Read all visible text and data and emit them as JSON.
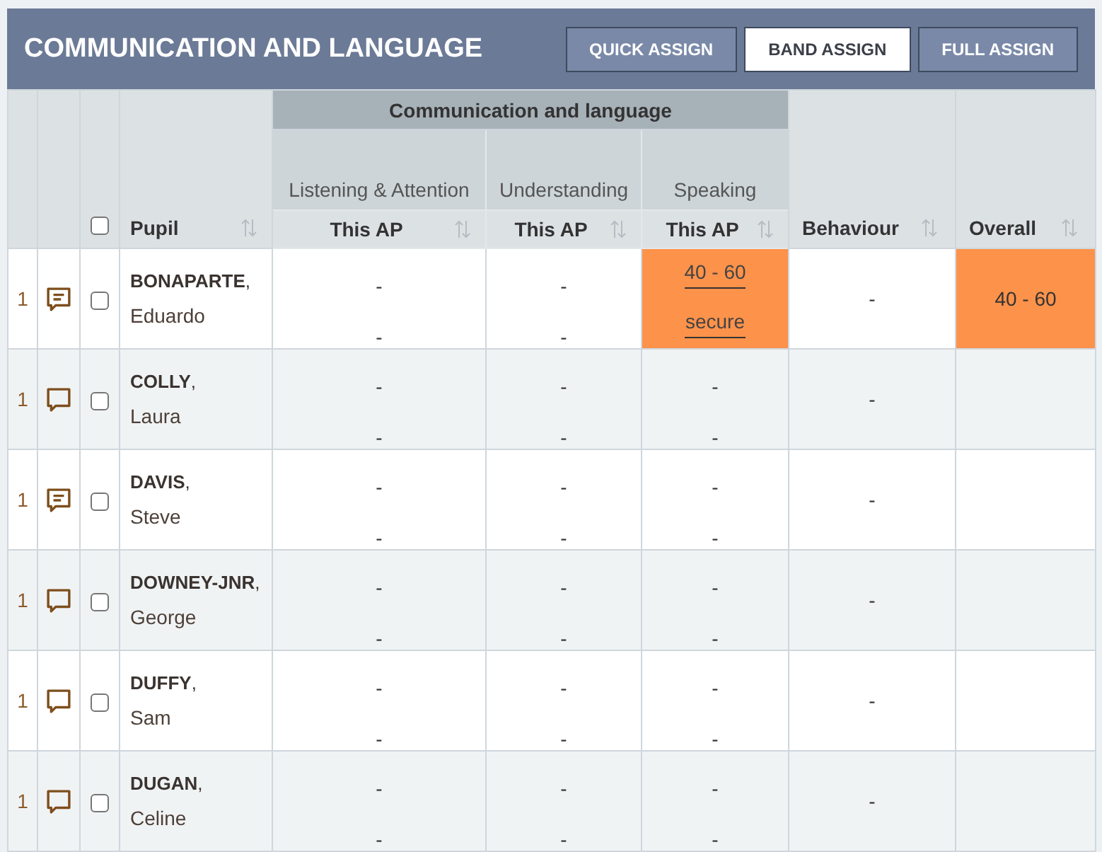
{
  "header": {
    "title": "COMMUNICATION AND LANGUAGE",
    "buttons": [
      {
        "label": "QUICK ASSIGN",
        "selected": false
      },
      {
        "label": "BAND ASSIGN",
        "selected": true
      },
      {
        "label": "FULL ASSIGN",
        "selected": false
      }
    ]
  },
  "table": {
    "select_all": {
      "checked": false
    },
    "pupil_heading": "Pupil",
    "group_heading": "Communication and language",
    "aspects": [
      {
        "name": "Listening & Attention",
        "heading": "This AP"
      },
      {
        "name": "Understanding",
        "heading": "This AP"
      },
      {
        "name": "Speaking",
        "heading": "This AP"
      }
    ],
    "behaviour_heading": "Behaviour",
    "overall_heading": "Overall",
    "rows": [
      {
        "number": "1",
        "has_comments": true,
        "checked": false,
        "surname": "**BONAPARTE**,",
        "first_name": "Eduardo",
        "aspects": [
          {
            "band": "-",
            "step": "-",
            "highlighted": false
          },
          {
            "band": "-",
            "step": "-",
            "highlighted": false
          },
          {
            "band": "40 - 60",
            "step": "secure",
            "highlighted": true
          }
        ],
        "behaviour": "-",
        "overall": {
          "value": "40 - 60",
          "highlighted": true
        }
      },
      {
        "number": "1",
        "has_comments": false,
        "checked": false,
        "surname": "**COLLY**,",
        "first_name": "Laura",
        "aspects": [
          {
            "band": "-",
            "step": "-",
            "highlighted": false
          },
          {
            "band": "-",
            "step": "-",
            "highlighted": false
          },
          {
            "band": "-",
            "step": "-",
            "highlighted": false
          }
        ],
        "behaviour": "-",
        "overall": {
          "highlighted": false
        }
      },
      {
        "number": "1",
        "has_comments": true,
        "checked": false,
        "surname": "**DAVIS**,",
        "first_name": "Steve",
        "aspects": [
          {
            "band": "-",
            "step": "-",
            "highlighted": false
          },
          {
            "band": "-",
            "step": "-",
            "highlighted": false
          },
          {
            "band": "-",
            "step": "-",
            "highlighted": false
          }
        ],
        "behaviour": "-",
        "overall": {
          "highlighted": false
        }
      },
      {
        "number": "1",
        "has_comments": false,
        "checked": false,
        "surname": "**DOWNEY-JNR**,",
        "first_name": "George",
        "aspects": [
          {
            "band": "-",
            "step": "-",
            "highlighted": false
          },
          {
            "band": "-",
            "step": "-",
            "highlighted": false
          },
          {
            "band": "-",
            "step": "-",
            "highlighted": false
          }
        ],
        "behaviour": "-",
        "overall": {
          "highlighted": false
        }
      },
      {
        "number": "1",
        "has_comments": false,
        "checked": false,
        "surname": "**DUFFY**,",
        "first_name": "Sam",
        "aspects": [
          {
            "band": "-",
            "step": "-",
            "highlighted": false
          },
          {
            "band": "-",
            "step": "-",
            "highlighted": false
          },
          {
            "band": "-",
            "step": "-",
            "highlighted": false
          }
        ],
        "behaviour": "-",
        "overall": {
          "highlighted": false
        }
      },
      {
        "number": "1",
        "has_comments": false,
        "checked": false,
        "surname": "**DUGAN**,",
        "first_name": "Celine",
        "aspects": [
          {
            "band": "-",
            "step": "-",
            "highlighted": false
          },
          {
            "band": "-",
            "step": "-",
            "highlighted": false
          },
          {
            "band": "-",
            "step": "-",
            "highlighted": false
          }
        ],
        "behaviour": "-",
        "overall": {
          "highlighted": false
        }
      }
    ]
  }
}
